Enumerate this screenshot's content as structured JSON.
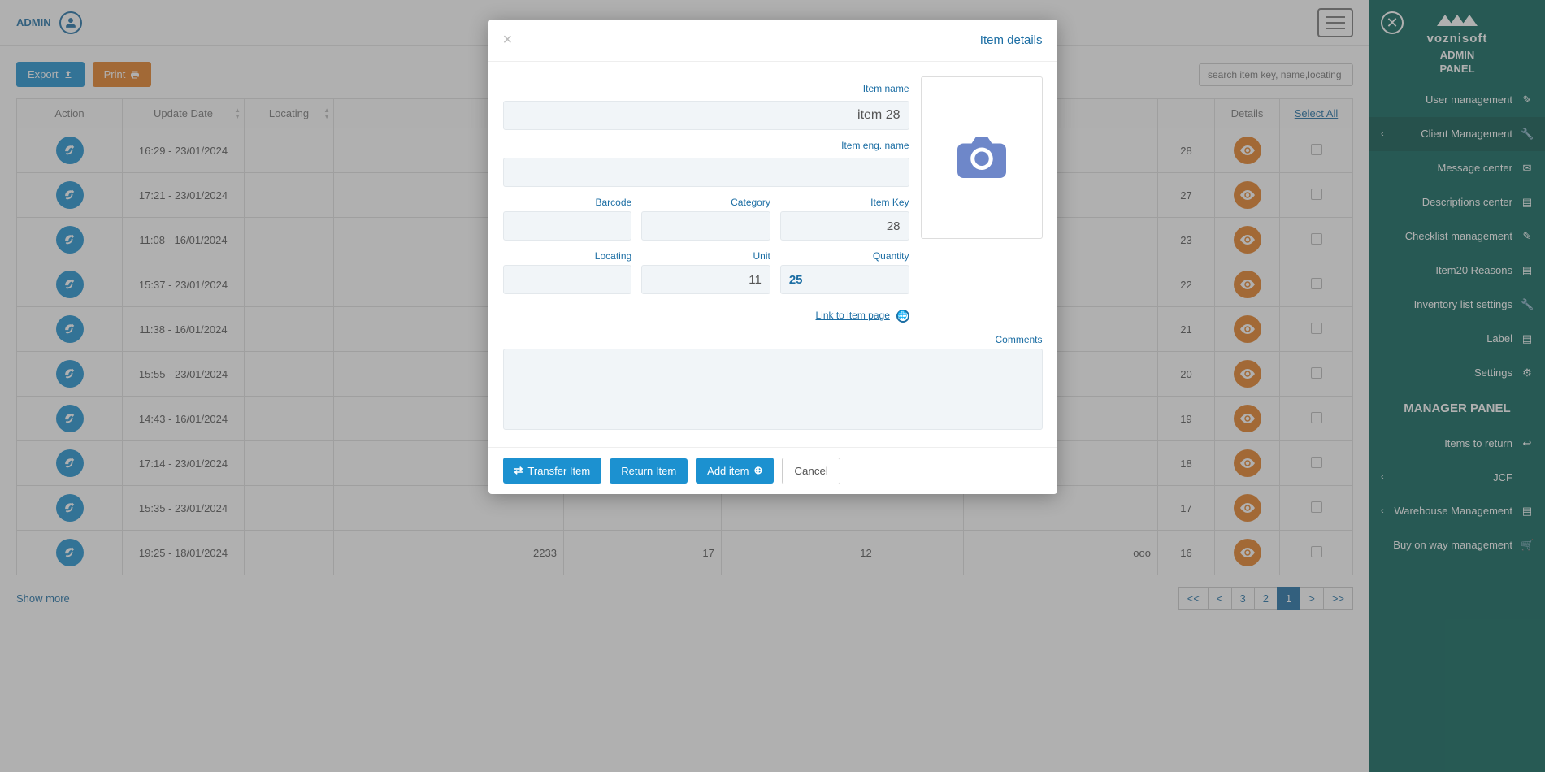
{
  "topbar": {
    "user": "ADMIN"
  },
  "toolbar": {
    "export": "Export",
    "print": "Print"
  },
  "search": {
    "placeholder": "search item key, name,locating"
  },
  "columns": {
    "action": "Action",
    "update": "Update Date",
    "locating": "Locating",
    "details": "Details",
    "select_all": "Select All"
  },
  "rows": [
    {
      "date": "16:29 - 23/01/2024",
      "key": "28"
    },
    {
      "date": "17:21 - 23/01/2024",
      "key": "27"
    },
    {
      "date": "11:08 - 16/01/2024",
      "key": "23"
    },
    {
      "date": "15:37 - 23/01/2024",
      "key": "22"
    },
    {
      "date": "11:38 - 16/01/2024",
      "key": "21"
    },
    {
      "date": "15:55 - 23/01/2024",
      "key": "20"
    },
    {
      "date": "14:43 - 16/01/2024",
      "key": "19"
    },
    {
      "date": "17:14 - 23/01/2024",
      "key": "18"
    },
    {
      "date": "15:35 - 23/01/2024",
      "key": "17"
    },
    {
      "date": "19:25 - 18/01/2024",
      "c1": "2233",
      "c2": "17",
      "c3": "12",
      "c4": "ooo",
      "key": "16"
    }
  ],
  "footer": {
    "show_more": "Show more"
  },
  "pager": {
    "first": "<<",
    "prev": "<",
    "p3": "3",
    "p2": "2",
    "p1": "1",
    "next": ">",
    "last": ">>"
  },
  "sidebar": {
    "brand": "voznisoft",
    "panel1": "ADMIN",
    "panel2": "PANEL",
    "items": [
      {
        "label": "User management",
        "icon": "✎"
      },
      {
        "label": "Client Management",
        "icon": "🔧",
        "chev": "‹"
      },
      {
        "label": "Message center",
        "icon": "✉"
      },
      {
        "label": "Descriptions center",
        "icon": "▤"
      },
      {
        "label": "Checklist management",
        "icon": "✎"
      },
      {
        "label": "Item20 Reasons",
        "icon": "▤"
      },
      {
        "label": "Inventory list settings",
        "icon": "🔧"
      },
      {
        "label": "Label",
        "icon": "▤"
      },
      {
        "label": "Settings",
        "icon": "⚙"
      }
    ],
    "section2": "MANAGER PANEL",
    "items2": [
      {
        "label": "Items to return",
        "icon": "↩"
      },
      {
        "label": "JCF",
        "icon": "",
        "chev": "‹"
      },
      {
        "label": "Warehouse Management",
        "icon": "▤",
        "chev": "‹"
      },
      {
        "label": "Buy on way management",
        "icon": "🛒"
      }
    ]
  },
  "modal": {
    "title": "Item details",
    "labels": {
      "name": "Item name",
      "eng": "Item eng. name",
      "barcode": "Barcode",
      "category": "Category",
      "key": "Item Key",
      "locating": "Locating",
      "unit": "Unit",
      "quantity": "Quantity",
      "link": "Link to item page",
      "comments": "Comments"
    },
    "values": {
      "name": "item 28",
      "key": "28",
      "unit": "11",
      "quantity": "25"
    },
    "buttons": {
      "transfer": "Transfer Item",
      "return": "Return Item",
      "add": "Add item",
      "cancel": "Cancel"
    }
  }
}
